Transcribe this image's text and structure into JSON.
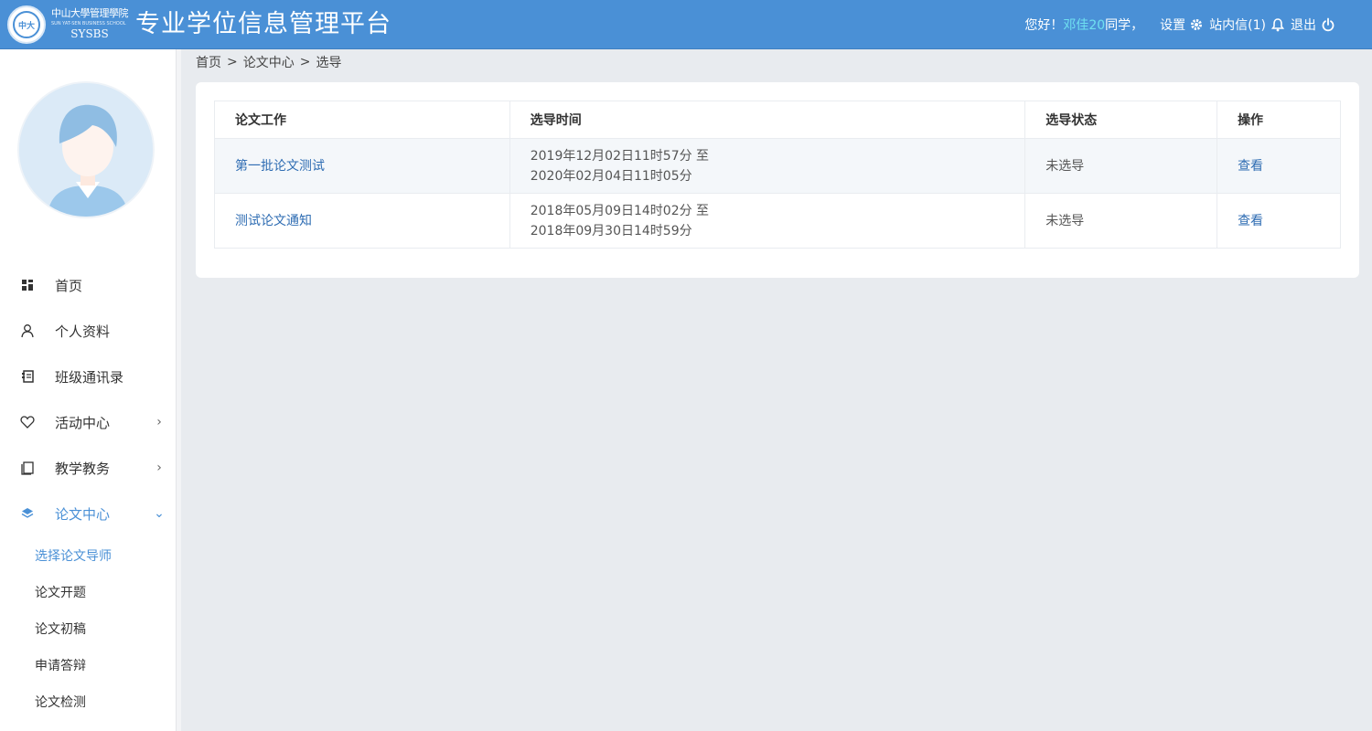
{
  "header": {
    "logo_text": "中大",
    "school_name_cn": "中山大學管理學院",
    "school_name_en": "SUN YAT-SEN BUSINESS SCHOOL",
    "school_abbr": "SYSBS",
    "app_title": "专业学位信息管理平台",
    "greeting_prefix": "您好！",
    "user_name": "邓佳20",
    "greeting_suffix": "同学，",
    "settings_label": "设置",
    "messages_label": "站内信(1)",
    "logout_label": "退出"
  },
  "sidebar": {
    "menu": [
      {
        "label": "首页",
        "icon": "dashboard-icon"
      },
      {
        "label": "个人资料",
        "icon": "user-icon"
      },
      {
        "label": "班级通讯录",
        "icon": "address-book-icon"
      },
      {
        "label": "活动中心",
        "icon": "heart-icon",
        "arrow": "›"
      },
      {
        "label": "教学教务",
        "icon": "book-icon",
        "arrow": "›"
      },
      {
        "label": "论文中心",
        "icon": "layers-icon",
        "arrow": "⌄"
      }
    ],
    "submenu": [
      "选择论文导师",
      "论文开题",
      "论文初稿",
      "申请答辩",
      "论文检测"
    ]
  },
  "breadcrumb": [
    "首页",
    ">",
    "论文中心",
    ">",
    "选导"
  ],
  "table": {
    "headers": [
      "论文工作",
      "选导时间",
      "选导状态",
      "操作"
    ],
    "rows": [
      {
        "name": "第一批论文测试",
        "time_line1": "2019年12月02日11时57分 至",
        "time_line2": "2020年02月04日11时05分",
        "status": "未选导",
        "action": "查看"
      },
      {
        "name": "测试论文通知",
        "time_line1": "2018年05月09日14时02分 至",
        "time_line2": "2018年09月30日14时59分",
        "status": "未选导",
        "action": "查看"
      }
    ]
  },
  "colors": {
    "header_bg": "#4a90d6",
    "accent": "#4a90d6",
    "link": "#2f6db3",
    "username": "#6fe0f0"
  }
}
